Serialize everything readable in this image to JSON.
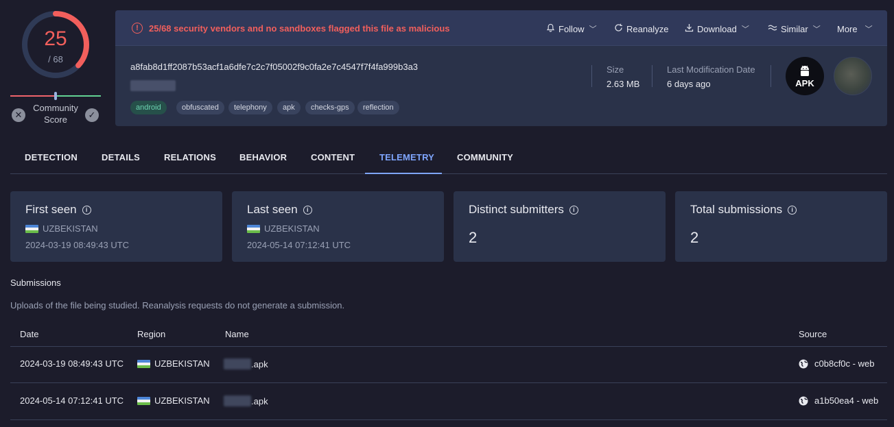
{
  "score": {
    "detected": "25",
    "total": "/ 68",
    "fraction": 0.368
  },
  "community": {
    "label": "Community\nScore",
    "label_line1": "Community",
    "label_line2": "Score"
  },
  "alert": {
    "text": "25/68 security vendors and no sandboxes flagged this file as malicious",
    "color": "#f25f5c"
  },
  "actions": [
    {
      "label": "Follow",
      "icon": "bell-icon"
    },
    {
      "label": "Reanalyze",
      "icon": "refresh-icon"
    },
    {
      "label": "Download",
      "icon": "download-icon"
    },
    {
      "label": "Similar",
      "icon": "similar-icon"
    },
    {
      "label": "More",
      "icon": "chevron-down-icon"
    }
  ],
  "file": {
    "hash": "a8fab8d1ff2087b53acf1a6dfe7c2c7f05002f9c0fa2e7c4547f7f4fa999b3a3",
    "tags": [
      "android",
      "obfuscated",
      "telephony",
      "apk",
      "checks-gps",
      "reflection"
    ],
    "size_label": "Size",
    "size_value": "2.63 MB",
    "mod_label": "Last Modification Date",
    "mod_value": "6 days ago",
    "type_badge": "APK"
  },
  "tabs": [
    "DETECTION",
    "DETAILS",
    "RELATIONS",
    "BEHAVIOR",
    "CONTENT",
    "TELEMETRY",
    "COMMUNITY"
  ],
  "active_tab": "TELEMETRY",
  "cards": {
    "first_seen": {
      "title": "First seen",
      "country": "UZBEKISTAN",
      "date": "2024-03-19 08:49:43 UTC"
    },
    "last_seen": {
      "title": "Last seen",
      "country": "UZBEKISTAN",
      "date": "2024-05-14 07:12:41 UTC"
    },
    "distinct": {
      "title": "Distinct submitters",
      "value": "2"
    },
    "total": {
      "title": "Total submissions",
      "value": "2"
    }
  },
  "submissions": {
    "title": "Submissions",
    "description": "Uploads of the file being studied. Reanalysis requests do not generate a submission.",
    "columns": {
      "date": "Date",
      "region": "Region",
      "name": "Name",
      "source": "Source"
    },
    "rows": [
      {
        "date": "2024-03-19 08:49:43 UTC",
        "region": "UZBEKISTAN",
        "name": ".apk",
        "source": "c0b8cf0c - web"
      },
      {
        "date": "2024-05-14 07:12:41 UTC",
        "region": "UZBEKISTAN",
        "name": ".apk",
        "source": "a1b50ea4 - web"
      }
    ]
  },
  "colors": {
    "accent": "#7fa6ff",
    "danger": "#f25f5c",
    "card": "#2a3249",
    "bg": "#1c1c2b"
  }
}
